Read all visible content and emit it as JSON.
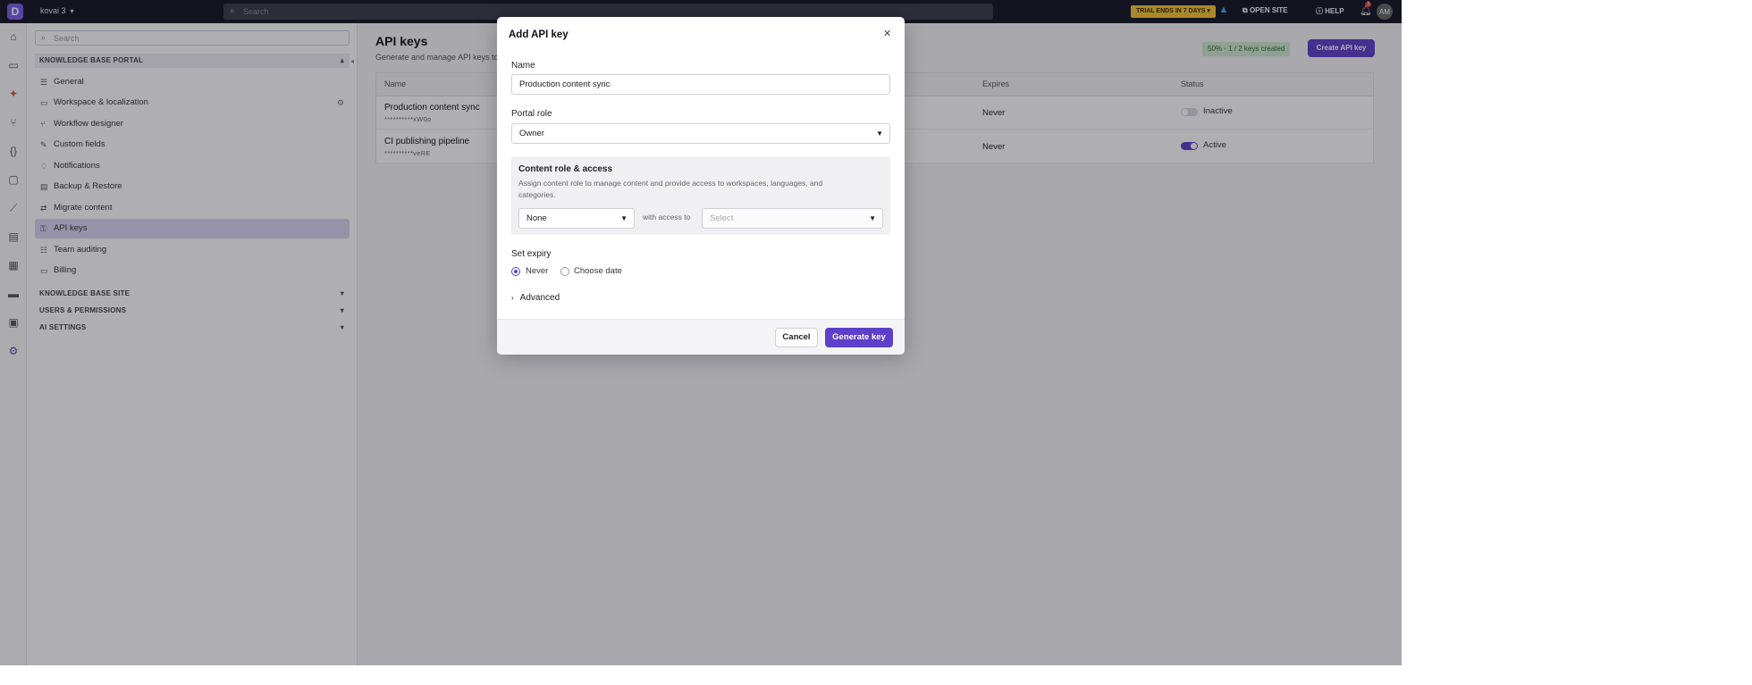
{
  "app": {
    "logo_letter": "D",
    "workspace": "kovai 3",
    "search_placeholder": "Search",
    "trial_badge": "TRIAL ENDS IN 7 DAYS",
    "open_site": "OPEN SITE",
    "help": "HELP",
    "notification_count": "3",
    "avatar_initials": "AM"
  },
  "sidebar": {
    "search_placeholder": "Search",
    "section_portal": "KNOWLEDGE BASE PORTAL",
    "items": [
      {
        "label": "General",
        "icon": "settings-sliders-icon"
      },
      {
        "label": "Workspace & localization",
        "icon": "workspace-icon"
      },
      {
        "label": "Workflow designer",
        "icon": "workflow-icon"
      },
      {
        "label": "Custom fields",
        "icon": "custom-fields-icon"
      },
      {
        "label": "Notifications",
        "icon": "bell-icon"
      },
      {
        "label": "Backup & Restore",
        "icon": "backup-icon"
      },
      {
        "label": "Migrate content",
        "icon": "migrate-icon"
      },
      {
        "label": "API keys",
        "icon": "key-icon"
      },
      {
        "label": "Team auditing",
        "icon": "audit-icon"
      },
      {
        "label": "Billing",
        "icon": "billing-icon"
      }
    ],
    "section_site": "KNOWLEDGE BASE SITE",
    "section_users": "USERS & PERMISSIONS",
    "section_ai": "AI SETTINGS"
  },
  "main": {
    "title": "API keys",
    "subtitle": "Generate and manage API keys to",
    "quota": "50% - 1 / 2 keys created",
    "create_button": "Create API key",
    "columns": {
      "name": "Name",
      "expires": "Expires",
      "status": "Status"
    },
    "rows": [
      {
        "name": "Production content sync",
        "key": "**********xW0o",
        "expires": "Never",
        "status": "Inactive",
        "active": false
      },
      {
        "name": "CI publishing pipeline",
        "key": "**********veRE",
        "expires": "Never",
        "status": "Active",
        "active": true
      }
    ]
  },
  "modal": {
    "title": "Add API key",
    "name_label": "Name",
    "name_value": "Production content sync",
    "portal_role_label": "Portal role",
    "portal_role_value": "Owner",
    "content_title": "Content role & access",
    "content_desc": "Assign content role to manage content and provide access to workspaces, languages, and categories.",
    "content_role_value": "None",
    "with_access_to": "with access to",
    "access_placeholder": "Select",
    "expiry_label": "Set expiry",
    "expiry_never": "Never",
    "expiry_choose": "Choose date",
    "expiry_selected": "Never",
    "advanced": "Advanced",
    "cancel": "Cancel",
    "generate": "Generate key"
  },
  "colors": {
    "accent": "#5d3fc9",
    "topbar": "#141424",
    "trial_badge": "#f5c431",
    "quota_badge": "#cfeacf"
  }
}
